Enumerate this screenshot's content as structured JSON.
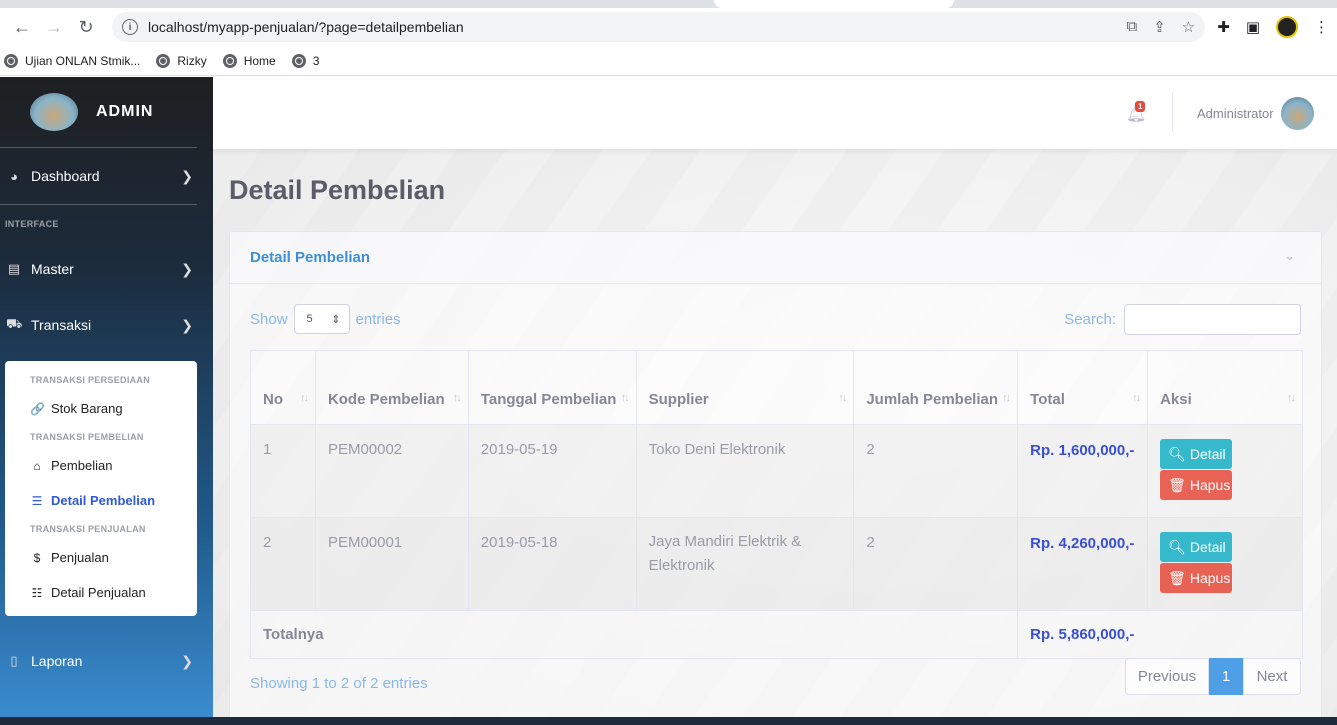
{
  "browser": {
    "url": "localhost/myapp-penjualan/?page=detailpembelian",
    "bookmarks": [
      "Ujian ONLAN Stmik...",
      "Rizky",
      "Home",
      "3"
    ]
  },
  "sidebar": {
    "brand": "ADMIN",
    "dashboard": "Dashboard",
    "interface_heading": "INTERFACE",
    "master": "Master",
    "transaksi": "Transaksi",
    "sub": {
      "h1": "TRANSAKSI PERSEDIAAN",
      "stok": "Stok Barang",
      "h2": "TRANSAKSI PEMBELIAN",
      "pembelian": "Pembelian",
      "detail_pembelian": "Detail Pembelian",
      "h3": "TRANSAKSI PENJUALAN",
      "penjualan": "Penjualan",
      "detail_penjualan": "Detail Penjualan"
    },
    "laporan": "Laporan"
  },
  "topbar": {
    "badge": "1",
    "user": "Administrator"
  },
  "page": {
    "title": "Detail Pembelian",
    "card_title": "Detail Pembelian",
    "show": "Show",
    "entries_value": "5",
    "entries": "entries",
    "search": "Search:"
  },
  "table": {
    "headers": [
      "No",
      "Kode Pembelian",
      "Tanggal Pembelian",
      "Supplier",
      "Jumlah Pembelian",
      "Total",
      "Aksi"
    ],
    "rows": [
      {
        "no": "1",
        "kode": "PEM00002",
        "tanggal": "2019-05-19",
        "supplier": "Toko Deni Elektronik",
        "jumlah": "2",
        "total": "Rp. 1,600,000,-"
      },
      {
        "no": "2",
        "kode": "PEM00001",
        "tanggal": "2019-05-18",
        "supplier": "Jaya Mandiri Elektrik & Elektronik",
        "jumlah": "2",
        "total": "Rp. 4,260,000,-"
      }
    ],
    "detail_label": "Detail",
    "hapus_label": "Hapus",
    "footer_label": "Totalnya",
    "footer_total": "Rp. 5,860,000,-"
  },
  "pagination": {
    "info": "Showing 1 to 2 of 2 entries",
    "previous": "Previous",
    "current": "1",
    "next": "Next"
  },
  "colors": {
    "primary": "#4e73df",
    "info": "#36b9cc",
    "danger": "#e74a3b"
  }
}
